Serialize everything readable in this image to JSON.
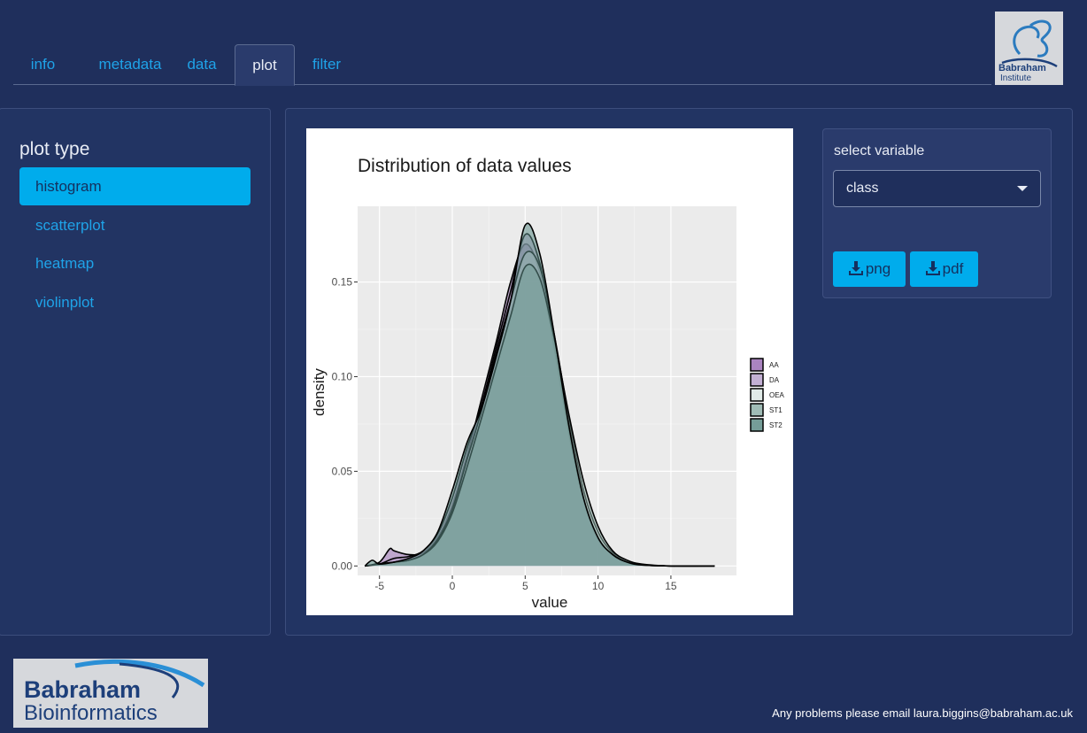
{
  "tabs": [
    {
      "label": "info"
    },
    {
      "label": "metadata"
    },
    {
      "label": "data"
    },
    {
      "label": "plot",
      "active": true
    },
    {
      "label": "filter"
    }
  ],
  "header_logo": {
    "line1": "Babraham",
    "line2": "Institute"
  },
  "sidebar": {
    "title": "plot type",
    "items": [
      {
        "label": "histogram",
        "active": true
      },
      {
        "label": "scatterplot"
      },
      {
        "label": "heatmap"
      },
      {
        "label": "violinplot"
      }
    ]
  },
  "controls": {
    "select_label": "select variable",
    "select_value": "class",
    "png_label": "png",
    "pdf_label": "pdf"
  },
  "chart_data": {
    "type": "area",
    "title": "Distribution of data values",
    "xlabel": "value",
    "ylabel": "density",
    "xlim": [
      -6.5,
      19.5
    ],
    "ylim": [
      -0.005,
      0.19
    ],
    "x_ticks": [
      -5,
      0,
      5,
      10,
      15
    ],
    "y_ticks": [
      0.0,
      0.05,
      0.1,
      0.15
    ],
    "y_tick_labels": [
      "0.00",
      "0.05",
      "0.10",
      "0.15"
    ],
    "grid": true,
    "legend_position": "right",
    "series": [
      {
        "name": "AA",
        "color": "#9b6fb5",
        "x": [
          -6,
          -5,
          -4.3,
          -4,
          -3,
          -2,
          -1,
          0,
          1,
          2,
          3,
          4,
          5,
          6,
          7,
          8,
          9,
          10,
          11,
          12,
          13,
          15,
          18
        ],
        "y": [
          0,
          0.002,
          0.009,
          0.008,
          0.006,
          0.007,
          0.015,
          0.032,
          0.058,
          0.088,
          0.118,
          0.15,
          0.17,
          0.155,
          0.115,
          0.07,
          0.035,
          0.014,
          0.006,
          0.002,
          0.0005,
          0,
          0
        ]
      },
      {
        "name": "DA",
        "color": "#b9a2cc",
        "x": [
          -6,
          -5,
          -4,
          -3,
          -2,
          -1,
          0,
          1,
          2,
          3,
          4,
          5,
          6,
          7,
          8,
          9,
          10,
          11,
          12,
          13,
          15,
          18
        ],
        "y": [
          0,
          0.001,
          0.004,
          0.005,
          0.008,
          0.017,
          0.036,
          0.062,
          0.085,
          0.115,
          0.145,
          0.175,
          0.16,
          0.12,
          0.072,
          0.036,
          0.015,
          0.006,
          0.002,
          0.0005,
          0,
          0
        ]
      },
      {
        "name": "OEA",
        "color": "#dce8e4",
        "x": [
          -6,
          -5,
          -4,
          -3,
          -2,
          -1,
          0,
          1,
          2,
          3,
          4,
          5,
          6,
          7,
          8,
          9,
          10,
          11,
          12,
          13,
          15,
          18
        ],
        "y": [
          0,
          0.001,
          0.002,
          0.003,
          0.006,
          0.014,
          0.03,
          0.056,
          0.082,
          0.112,
          0.14,
          0.165,
          0.158,
          0.122,
          0.078,
          0.04,
          0.018,
          0.007,
          0.002,
          0.0005,
          0,
          0
        ]
      },
      {
        "name": "ST1",
        "color": "#8fb0a9",
        "x": [
          -6,
          -5,
          -4,
          -3,
          -2,
          -1,
          0,
          1,
          2,
          3,
          4,
          5,
          6,
          7,
          8,
          9,
          10,
          11,
          12,
          13,
          15,
          18
        ],
        "y": [
          0,
          0.001,
          0.002,
          0.003,
          0.006,
          0.013,
          0.028,
          0.052,
          0.078,
          0.105,
          0.132,
          0.158,
          0.152,
          0.12,
          0.08,
          0.045,
          0.021,
          0.008,
          0.003,
          0.001,
          0,
          0
        ]
      },
      {
        "name": "ST2",
        "color": "#5d8c86",
        "x": [
          -6,
          -5.5,
          -5,
          -4,
          -3,
          -2,
          -1,
          0,
          1,
          2,
          3,
          4,
          5,
          6,
          7,
          8,
          9,
          10,
          11,
          12,
          13,
          15,
          18
        ],
        "y": [
          0,
          0.003,
          0.001,
          0.002,
          0.004,
          0.008,
          0.018,
          0.04,
          0.065,
          0.083,
          0.11,
          0.14,
          0.18,
          0.165,
          0.122,
          0.074,
          0.036,
          0.015,
          0.006,
          0.002,
          0.0005,
          0,
          0
        ]
      }
    ]
  },
  "footer": {
    "logo_line1": "Babraham",
    "logo_line2": "Bioinformatics",
    "contact": "Any problems please email laura.biggins@babraham.ac.uk"
  }
}
